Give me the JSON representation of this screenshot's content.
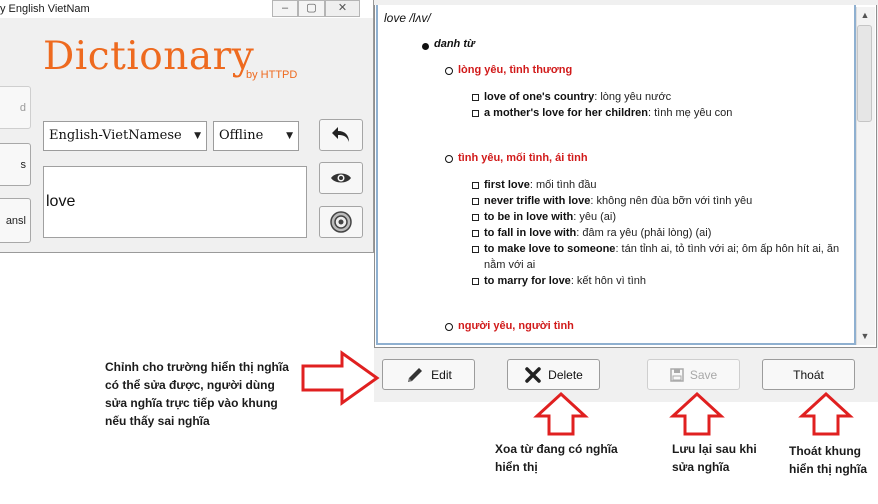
{
  "left_window": {
    "title": "y English VietNam",
    "logo": "Dictionary",
    "logo_sub": "by HTTPD",
    "side_buttons": [
      "d",
      "s",
      "ansl"
    ],
    "language_select": "English-VietNamese",
    "mode_select": "Offline",
    "search_text": "love"
  },
  "definition": {
    "headword": "love /lʌv/",
    "part_of_speech": "danh từ",
    "senses": [
      {
        "label": "lòng yêu, tình thương",
        "examples": [
          {
            "phrase": "love of one's country",
            "meaning": ": lòng yêu nước"
          },
          {
            "phrase": "a mother's love for her children",
            "meaning": ": tình mẹ yêu con"
          }
        ]
      },
      {
        "label": "tình yêu, mối tình, ái tình",
        "examples": [
          {
            "phrase": "first love",
            "meaning": ": mối tình đầu"
          },
          {
            "phrase": "never trifle with love",
            "meaning": ": không nên đùa bỡn với tình yêu"
          },
          {
            "phrase": "to be in love with",
            "meaning": ": yêu (ai)"
          },
          {
            "phrase": "to fall in love with",
            "meaning": ": đâm ra yêu (phải lòng) (ai)"
          },
          {
            "phrase": "to make love to someone",
            "meaning": ": tán tỉnh ai, tỏ tình với ai; ôm ấp hôn hít ai, ăn nằm với ai"
          },
          {
            "phrase": "to marry for love",
            "meaning": ": kết hôn vì tình"
          }
        ]
      },
      {
        "label": "người yêu, người tình",
        "examples": []
      }
    ]
  },
  "actions": {
    "edit": "Edit",
    "delete": "Delete",
    "save": "Save",
    "exit": "Thoát"
  },
  "annotations": {
    "edit_note": "Chỉnh cho trường hiển thị nghĩa có thể sửa được, người dùng sửa nghĩa trực tiếp vào khung nếu thấy sai nghĩa",
    "delete_note": "Xoa từ đang có nghĩa hiển thị",
    "save_note": "Lưu lại sau khi sửa nghĩa",
    "exit_note": "Thoát khung hiển thị nghĩa"
  },
  "colors": {
    "logo": "#ee6a1f",
    "sense_red": "#d11a1a",
    "arrow_red": "#e02020",
    "frame_blue": "#8fb0d0"
  },
  "icons": [
    "undo-arrow-icon",
    "eye-icon",
    "speaker-icon",
    "pencil-icon",
    "x-icon",
    "floppy-icon"
  ]
}
